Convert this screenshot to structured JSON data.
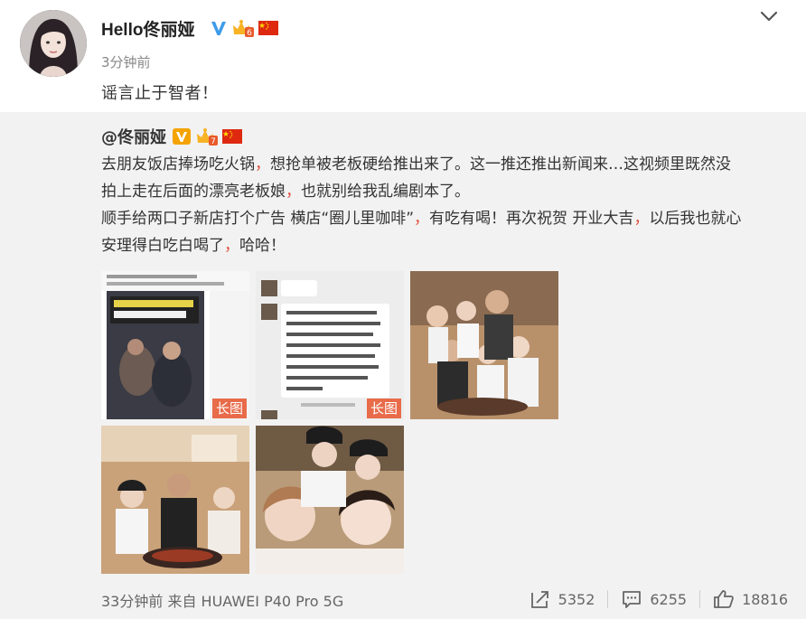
{
  "post": {
    "username": "Hello佟丽娅",
    "time": "3分钟前",
    "text": "谣言止于智者！",
    "vip_level": "6"
  },
  "repost": {
    "author": "@佟丽娅",
    "vip_level": "7",
    "line1a": "去朋友饭店捧场吃火锅",
    "line1b": "想抢单被老板硬给推出来了。这一推还推出新闻来…这视频里既然没",
    "line2a": "拍上走在后面的漂亮老板娘",
    "line2b": "也就别给我乱编剧本了。",
    "line3a": "顺手给两口子新店打个广告 横店“圈儿里咖啡”",
    "line3b": "有吃有喝！再次祝贺 开业大吉",
    "line3c": "以后我也就心",
    "line4a": "安理得白吃白喝了",
    "line4b": "哈哈！",
    "comma": "，",
    "images": [
      {
        "badge": "长图"
      },
      {
        "badge": "长图"
      },
      {
        "badge": ""
      },
      {
        "badge": ""
      },
      {
        "badge": ""
      }
    ]
  },
  "footer": {
    "source": "33分钟前 来自 HUAWEI P40 Pro 5G",
    "reposts": "5352",
    "comments": "6255",
    "likes": "18816"
  },
  "colors": {
    "repost_bg": "#f2f2f2",
    "verified_blue": "#3d9be9",
    "verified_gold": "#f4a300",
    "long_badge": "#e86b4a",
    "comma_red": "#e04a3a"
  }
}
